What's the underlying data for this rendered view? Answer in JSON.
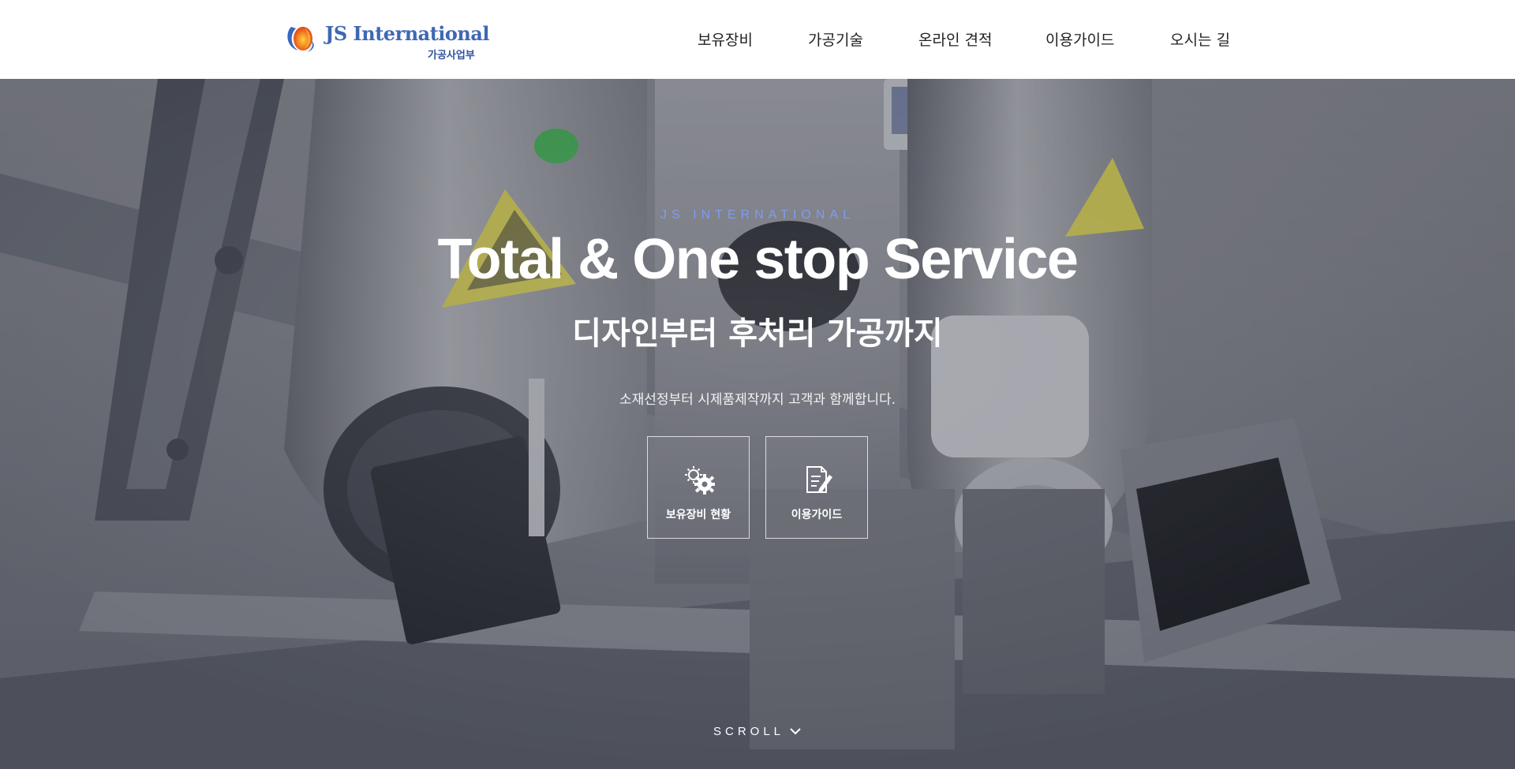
{
  "header": {
    "logo": {
      "name": "JS International",
      "sub": "가공사업부",
      "icon": "flame-globe-logo"
    },
    "nav": [
      {
        "label": "보유장비"
      },
      {
        "label": "가공기술"
      },
      {
        "label": "온라인 견적"
      },
      {
        "label": "이용가이드"
      },
      {
        "label": "오시는 길"
      }
    ]
  },
  "hero": {
    "eyebrow": "JS INTERNATIONAL",
    "title": "Total & One stop Service",
    "subtitle": "디자인부터 후처리 가공까지",
    "description": "소재선정부터 시제품제작까지 고객과 함께합니다.",
    "buttons": [
      {
        "label": "보유장비 현황",
        "icon": "gears-icon"
      },
      {
        "label": "이용가이드",
        "icon": "document-edit-icon"
      }
    ],
    "scroll_label": "SCROLL",
    "scroll_icon": "chevron-down-icon"
  },
  "colors": {
    "eyebrow": "#7f9cf0",
    "logo_blue": "#3f67b4",
    "logo_orange": "#e8582a"
  }
}
